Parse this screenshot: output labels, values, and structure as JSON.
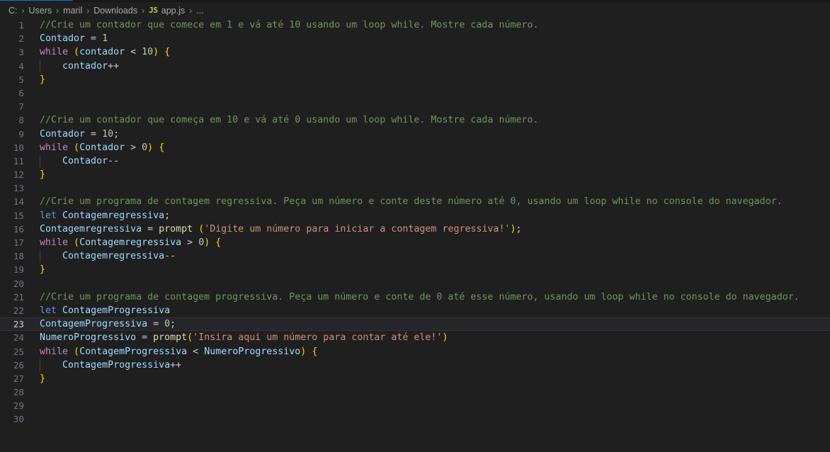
{
  "window": {
    "background": "#1f1f1f",
    "active_tab_accent": "#0078d4"
  },
  "breadcrumb": {
    "name": "breadcrumb",
    "items": [
      {
        "label": "C:",
        "type": "drive"
      },
      {
        "label": "Users",
        "type": "folder"
      },
      {
        "label": "maril",
        "type": "folder"
      },
      {
        "label": "Downloads",
        "type": "folder"
      },
      {
        "label": "app.js",
        "type": "file",
        "icon": "js-icon",
        "icon_label": "JS"
      },
      {
        "label": "...",
        "type": "overflow"
      }
    ],
    "separator": "›"
  },
  "editor": {
    "language": "javascript",
    "file_name": "app.js",
    "current_line": 23,
    "total_lines_shown": 30,
    "colors": {
      "comment": "#6a9955",
      "keyword": "#569cd6",
      "control": "#c586c0",
      "variable": "#9cdcfe",
      "function": "#dcdcaa",
      "number": "#b5cea8",
      "string": "#ce9178",
      "bracket1": "#ffd700",
      "bracket2": "#da70d6",
      "default": "#cccccc",
      "line_number": "#6e7681",
      "current_line_bg": "#26262a",
      "current_line_border": "#333338",
      "indent_guide": "#404040"
    },
    "lines": [
      {
        "n": 1,
        "text": "//Crie um contador que comece em 1 e vá até 10 usando um loop while. Mostre cada número."
      },
      {
        "n": 2,
        "text": "Contador = 1"
      },
      {
        "n": 3,
        "text": "while (contador < 10) {"
      },
      {
        "n": 4,
        "text": "    contador++"
      },
      {
        "n": 5,
        "text": "}"
      },
      {
        "n": 6,
        "text": ""
      },
      {
        "n": 7,
        "text": ""
      },
      {
        "n": 8,
        "text": "//Crie um contador que começa em 10 e vá até 0 usando um loop while. Mostre cada número."
      },
      {
        "n": 9,
        "text": "Contador = 10;"
      },
      {
        "n": 10,
        "text": "while (Contador > 0) {"
      },
      {
        "n": 11,
        "text": "    Contador--"
      },
      {
        "n": 12,
        "text": "}"
      },
      {
        "n": 13,
        "text": ""
      },
      {
        "n": 14,
        "text": "//Crie um programa de contagem regressiva. Peça um número e conte deste número até 0, usando um loop while no console do navegador."
      },
      {
        "n": 15,
        "text": "let Contagemregressiva;"
      },
      {
        "n": 16,
        "text": "Contagemregressiva = prompt ('Digite um número para iniciar a contagem regressiva!');"
      },
      {
        "n": 17,
        "text": "while (Contagemregressiva > 0) {"
      },
      {
        "n": 18,
        "text": "    Contagemregressiva--"
      },
      {
        "n": 19,
        "text": "}"
      },
      {
        "n": 20,
        "text": ""
      },
      {
        "n": 21,
        "text": "//Crie um programa de contagem progressiva. Peça um número e conte de 0 até esse número, usando um loop while no console do navegador."
      },
      {
        "n": 22,
        "text": "let ContagemProgressiva"
      },
      {
        "n": 23,
        "text": "ContagemProgressiva = 0;"
      },
      {
        "n": 24,
        "text": "NumeroProgressivo = prompt('Insira aqui um número para contar até ele!')"
      },
      {
        "n": 25,
        "text": "while (ContagemProgressiva < NumeroProgressivo) {"
      },
      {
        "n": 26,
        "text": "    ContagemProgressiva++"
      },
      {
        "n": 27,
        "text": "}"
      },
      {
        "n": 28,
        "text": ""
      },
      {
        "n": 29,
        "text": ""
      },
      {
        "n": 30,
        "text": ""
      }
    ],
    "tokens": [
      {
        "n": 1,
        "parts": [
          [
            "comment",
            "//Crie um contador que comece em 1 e vá até 10 usando um loop while. Mostre cada número."
          ]
        ]
      },
      {
        "n": 2,
        "parts": [
          [
            "var",
            "Contador"
          ],
          [
            "default",
            " = "
          ],
          [
            "num",
            "1"
          ]
        ]
      },
      {
        "n": 3,
        "parts": [
          [
            "control",
            "while"
          ],
          [
            "default",
            " "
          ],
          [
            "br1",
            "("
          ],
          [
            "var",
            "contador"
          ],
          [
            "default",
            " < "
          ],
          [
            "num",
            "10"
          ],
          [
            "br1",
            ")"
          ],
          [
            "default",
            " "
          ],
          [
            "br1",
            "{"
          ]
        ]
      },
      {
        "n": 4,
        "parts": [
          [
            "default",
            "    "
          ],
          [
            "var",
            "contador"
          ],
          [
            "default",
            "++"
          ]
        ]
      },
      {
        "n": 5,
        "parts": [
          [
            "br1",
            "}"
          ]
        ]
      },
      {
        "n": 6,
        "parts": []
      },
      {
        "n": 7,
        "parts": []
      },
      {
        "n": 8,
        "parts": [
          [
            "comment",
            "//Crie um contador que começa em 10 e vá até 0 usando um loop while. Mostre cada número."
          ]
        ]
      },
      {
        "n": 9,
        "parts": [
          [
            "var",
            "Contador"
          ],
          [
            "default",
            " = "
          ],
          [
            "num",
            "10"
          ],
          [
            "default",
            ";"
          ]
        ]
      },
      {
        "n": 10,
        "parts": [
          [
            "control",
            "while"
          ],
          [
            "default",
            " "
          ],
          [
            "br1",
            "("
          ],
          [
            "var",
            "Contador"
          ],
          [
            "default",
            " > "
          ],
          [
            "num",
            "0"
          ],
          [
            "br1",
            ")"
          ],
          [
            "default",
            " "
          ],
          [
            "br1",
            "{"
          ]
        ]
      },
      {
        "n": 11,
        "parts": [
          [
            "default",
            "    "
          ],
          [
            "var",
            "Contador"
          ],
          [
            "default",
            "--"
          ]
        ]
      },
      {
        "n": 12,
        "parts": [
          [
            "br1",
            "}"
          ]
        ]
      },
      {
        "n": 13,
        "parts": []
      },
      {
        "n": 14,
        "parts": [
          [
            "comment",
            "//Crie um programa de contagem regressiva. Peça um número e conte deste número até 0, usando um loop while no console do navegador."
          ]
        ]
      },
      {
        "n": 15,
        "parts": [
          [
            "keyword",
            "let"
          ],
          [
            "default",
            " "
          ],
          [
            "var",
            "Contagemregressiva"
          ],
          [
            "default",
            ";"
          ]
        ]
      },
      {
        "n": 16,
        "parts": [
          [
            "var",
            "Contagemregressiva"
          ],
          [
            "default",
            " = "
          ],
          [
            "func",
            "prompt"
          ],
          [
            "default",
            " "
          ],
          [
            "br1",
            "("
          ],
          [
            "str",
            "'Digite um número para iniciar a contagem regressiva!'"
          ],
          [
            "br1",
            ")"
          ],
          [
            "default",
            ";"
          ]
        ]
      },
      {
        "n": 17,
        "parts": [
          [
            "control",
            "while"
          ],
          [
            "default",
            " "
          ],
          [
            "br1",
            "("
          ],
          [
            "var",
            "Contagemregressiva"
          ],
          [
            "default",
            " > "
          ],
          [
            "num",
            "0"
          ],
          [
            "br1",
            ")"
          ],
          [
            "default",
            " "
          ],
          [
            "br1",
            "{"
          ]
        ]
      },
      {
        "n": 18,
        "parts": [
          [
            "default",
            "    "
          ],
          [
            "var",
            "Contagemregressiva"
          ],
          [
            "default",
            "--"
          ]
        ]
      },
      {
        "n": 19,
        "parts": [
          [
            "br1",
            "}"
          ]
        ]
      },
      {
        "n": 20,
        "parts": []
      },
      {
        "n": 21,
        "parts": [
          [
            "comment",
            "//Crie um programa de contagem progressiva. Peça um número e conte de 0 até esse número, usando um loop while no console do navegador."
          ]
        ]
      },
      {
        "n": 22,
        "parts": [
          [
            "keyword",
            "let"
          ],
          [
            "default",
            " "
          ],
          [
            "var",
            "ContagemProgressiva"
          ]
        ]
      },
      {
        "n": 23,
        "parts": [
          [
            "var",
            "ContagemProgressiva"
          ],
          [
            "default",
            " = "
          ],
          [
            "num",
            "0"
          ],
          [
            "default",
            ";"
          ]
        ]
      },
      {
        "n": 24,
        "parts": [
          [
            "var",
            "NumeroProgressivo"
          ],
          [
            "default",
            " = "
          ],
          [
            "func",
            "prompt"
          ],
          [
            "br1",
            "("
          ],
          [
            "str",
            "'Insira aqui um número para contar até ele!'"
          ],
          [
            "br1",
            ")"
          ]
        ]
      },
      {
        "n": 25,
        "parts": [
          [
            "control",
            "while"
          ],
          [
            "default",
            " "
          ],
          [
            "br1",
            "("
          ],
          [
            "var",
            "ContagemProgressiva"
          ],
          [
            "default",
            " < "
          ],
          [
            "var",
            "NumeroProgressivo"
          ],
          [
            "br1",
            ")"
          ],
          [
            "default",
            " "
          ],
          [
            "br1",
            "{"
          ]
        ]
      },
      {
        "n": 26,
        "parts": [
          [
            "default",
            "    "
          ],
          [
            "var",
            "ContagemProgressiva"
          ],
          [
            "default",
            "++"
          ]
        ]
      },
      {
        "n": 27,
        "parts": [
          [
            "br1",
            "}"
          ]
        ]
      },
      {
        "n": 28,
        "parts": []
      },
      {
        "n": 29,
        "parts": []
      },
      {
        "n": 30,
        "parts": []
      }
    ],
    "indent_guide_lines": [
      4,
      11,
      18,
      26
    ]
  }
}
